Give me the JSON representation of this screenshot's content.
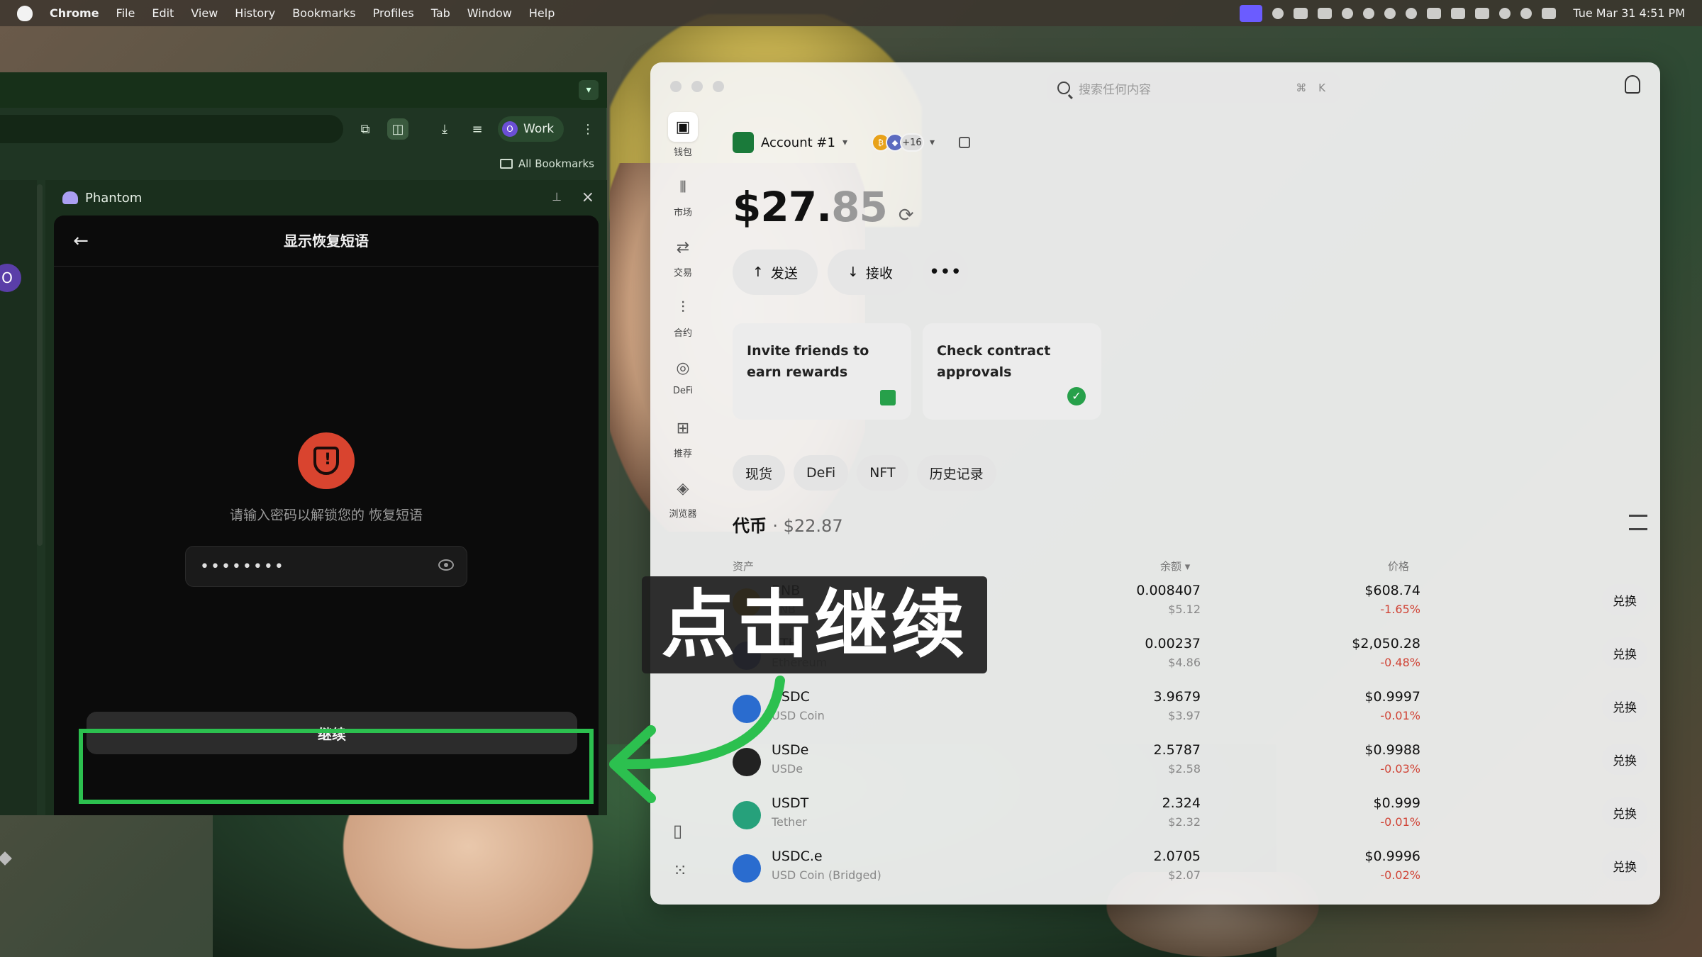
{
  "menubar": {
    "app_name": "Chrome",
    "items": [
      "File",
      "Edit",
      "View",
      "History",
      "Bookmarks",
      "Profiles",
      "Tab",
      "Window",
      "Help"
    ],
    "clock": "Tue Mar 31  4:51 PM"
  },
  "chrome": {
    "profile_initial": "O",
    "profile_label": "Work",
    "bookmarks_label": "All Bookmarks",
    "page_avatar_initial": "O"
  },
  "sidepanel": {
    "title": "Phantom"
  },
  "phantom": {
    "title": "显示恢复短语",
    "prompt": "请输入密码以解锁您的 恢复短语",
    "password_mask": "••••••••",
    "continue_label": "继续"
  },
  "overlay": {
    "callout": "点击继续",
    "highlight_color": "#2cc04f"
  },
  "wallet": {
    "search_placeholder": "搜索任何内容",
    "search_shortcut": "⌘ K",
    "nav": [
      {
        "label": "钱包",
        "icon": "wallet-icon"
      },
      {
        "label": "市场",
        "icon": "candlestick-icon"
      },
      {
        "label": "交易",
        "icon": "swap-arrows-icon"
      },
      {
        "label": "合约",
        "icon": "bars-icon"
      },
      {
        "label": "DeFi",
        "icon": "defi-icon"
      },
      {
        "label": "推荐",
        "icon": "gift-icon"
      },
      {
        "label": "浏览器",
        "icon": "compass-icon"
      }
    ],
    "account_name": "Account #1",
    "chain_more": "+16",
    "balance_main": "$27.",
    "balance_cents": "85",
    "actions": {
      "send": "发送",
      "receive": "接收"
    },
    "promos": [
      {
        "text": "Invite friends to earn rewards"
      },
      {
        "text": "Check contract approvals"
      }
    ],
    "tabs": [
      "现货",
      "DeFi",
      "NFT",
      "历史记录"
    ],
    "tokens_title": "代币",
    "tokens_total": "· $22.87",
    "columns": {
      "asset": "资产",
      "balance": "余额",
      "price": "价格"
    },
    "swap_label": "兑换",
    "tokens": [
      {
        "symbol": "BNB",
        "name": "BNB",
        "amount": "0.008407",
        "usd": "$5.12",
        "price": "$608.74",
        "change": "-1.65%",
        "color": "#e8b21a"
      },
      {
        "symbol": "ETH",
        "name": "Ethereum",
        "amount": "0.00237",
        "usd": "$4.86",
        "price": "$2,050.28",
        "change": "-0.48%",
        "color": "#5c6bc0"
      },
      {
        "symbol": "USDC",
        "name": "USD Coin",
        "amount": "3.9679",
        "usd": "$3.97",
        "price": "$0.9997",
        "change": "-0.01%",
        "color": "#2a6ccf"
      },
      {
        "symbol": "USDe",
        "name": "USDe",
        "amount": "2.5787",
        "usd": "$2.58",
        "price": "$0.9988",
        "change": "-0.03%",
        "color": "#222222"
      },
      {
        "symbol": "USDT",
        "name": "Tether",
        "amount": "2.324",
        "usd": "$2.32",
        "price": "$0.999",
        "change": "-0.01%",
        "color": "#26a17b"
      },
      {
        "symbol": "USDC.e",
        "name": "USD Coin (Bridged)",
        "amount": "2.0705",
        "usd": "$2.07",
        "price": "$0.9996",
        "change": "-0.02%",
        "color": "#2a6ccf"
      }
    ]
  }
}
